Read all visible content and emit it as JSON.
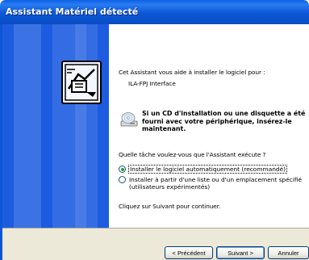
{
  "window": {
    "title": "Assistant Matériel détecté"
  },
  "content": {
    "intro": "Cet Assistant vous aide à installer le logiciel pour :",
    "device_name": "ILA-FPJ Interface",
    "cd_message_lines": [
      "Si un CD d'installation ou une disquette a été",
      "fourni avec votre périphérique, insérez-le",
      "maintenant."
    ],
    "question": "Quelle tâche voulez-vous que l'Assistant exécute ?",
    "options": [
      {
        "lines": [
          "Installer le logiciel automatiquement (recommandé)"
        ],
        "selected": true
      },
      {
        "lines": [
          "Installer à partir d'une liste ou d'un emplacement spécifié",
          "(utilisateurs expérimentés)"
        ],
        "selected": false
      }
    ],
    "continue_hint": "Cliquez sur Suivant pour continuer."
  },
  "buttons": {
    "prev": "< Précédent",
    "next": "Suivant >",
    "cancel": "Annuler"
  },
  "colors": {
    "titlebar": "#0b57d6",
    "sidebar": "#1d5ce0",
    "button_bar": "#ece9d8",
    "radio_selected": "#21a121"
  },
  "icons": {
    "sidebar": "hardware-wizard-icon",
    "cd": "cd-drive-icon"
  }
}
